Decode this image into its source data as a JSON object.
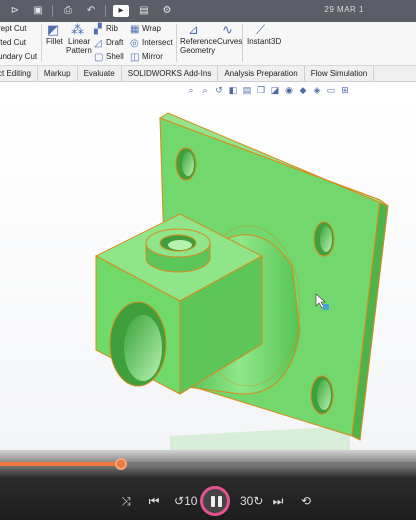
{
  "quick_access": {
    "icons": [
      "open-icon",
      "save-icon",
      "print-icon",
      "undo-icon",
      "select-icon",
      "rebuild-icon",
      "options-icon"
    ],
    "date": "29 MAR 1"
  },
  "ribbon": {
    "cut_group": [
      "rept Cut",
      "fted Cut",
      "undary Cut"
    ],
    "fillet": "Fillet",
    "linear_pattern": [
      "Linear",
      "Pattern"
    ],
    "col_rib": [
      "Rib",
      "Draft",
      "Shell"
    ],
    "col_wrap": [
      "Wrap",
      "Intersect",
      "Mirror"
    ],
    "reference_geometry": [
      "Reference",
      "Geometry"
    ],
    "curves": "Curves",
    "instant3d": "Instant3D"
  },
  "tabs": [
    "ct Editing",
    "Markup",
    "Evaluate",
    "SOLIDWORKS Add-Ins",
    "Analysis Preparation",
    "Flow Simulation"
  ],
  "view_toolbar": [
    "zoom-fit-icon",
    "zoom-area-icon",
    "previous-view-icon",
    "section-view-icon",
    "dynamic-annotation-icon",
    "view-orientation-icon",
    "display-style-icon",
    "hide-show-icon",
    "edit-appearance-icon",
    "scene-icon",
    "display-settings-icon",
    "monitor-icon"
  ],
  "colors": {
    "model_green": "#6fd96a",
    "edge_orange": "#d98a1c",
    "progress": "#ef7a3c",
    "play_ring": "#e4548f"
  },
  "player": {
    "progress": 0.29,
    "controls": [
      "shuffle-icon",
      "skip-back-icon",
      "rewind-10-icon",
      "pause-icon",
      "forward-30-icon",
      "skip-forward-icon",
      "repeat-icon"
    ],
    "rewind_label": "10",
    "forward_label": "30"
  }
}
